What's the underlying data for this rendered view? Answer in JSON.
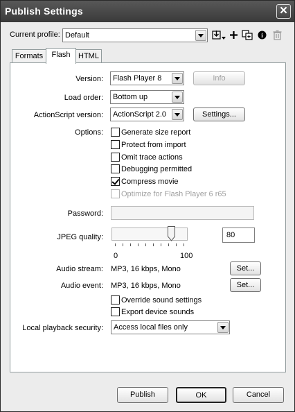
{
  "window": {
    "title": "Publish Settings",
    "close_glyph": "✕"
  },
  "profile": {
    "label": "Current profile:",
    "value": "Default"
  },
  "toolbar_icons": [
    "import-export-icon",
    "add-icon",
    "duplicate-icon",
    "info-icon",
    "delete-icon"
  ],
  "tabs": [
    {
      "label": "Formats",
      "active": false
    },
    {
      "label": "Flash",
      "active": true
    },
    {
      "label": "HTML",
      "active": false
    }
  ],
  "version": {
    "label": "Version:",
    "value": "Flash Player 8",
    "info_button": "Info"
  },
  "load_order": {
    "label": "Load order:",
    "value": "Bottom up"
  },
  "actionscript": {
    "label": "ActionScript version:",
    "value": "ActionScript 2.0",
    "settings_button": "Settings..."
  },
  "options": {
    "label": "Options:",
    "items": [
      {
        "label": "Generate size report",
        "checked": false,
        "enabled": true
      },
      {
        "label": "Protect from import",
        "checked": false,
        "enabled": true
      },
      {
        "label": "Omit trace actions",
        "checked": false,
        "enabled": true
      },
      {
        "label": "Debugging permitted",
        "checked": false,
        "enabled": true
      },
      {
        "label": "Compress movie",
        "checked": true,
        "enabled": true
      },
      {
        "label": "Optimize for Flash Player 6 r65",
        "checked": false,
        "enabled": false
      }
    ]
  },
  "password": {
    "label": "Password:",
    "value": ""
  },
  "jpeg": {
    "label": "JPEG quality:",
    "value": "80",
    "min_label": "0",
    "max_label": "100",
    "slider_level": 0.8
  },
  "audio_stream": {
    "label": "Audio stream:",
    "value": "MP3, 16 kbps, Mono",
    "button": "Set..."
  },
  "audio_event": {
    "label": "Audio event:",
    "value": "MP3, 16 kbps, Mono",
    "button": "Set..."
  },
  "sound_options": [
    {
      "label": "Override sound settings",
      "checked": false
    },
    {
      "label": "Export device sounds",
      "checked": false
    }
  ],
  "security": {
    "label": "Local playback security:",
    "value": "Access local files only"
  },
  "footer": {
    "publish": "Publish",
    "ok": "OK",
    "cancel": "Cancel"
  }
}
